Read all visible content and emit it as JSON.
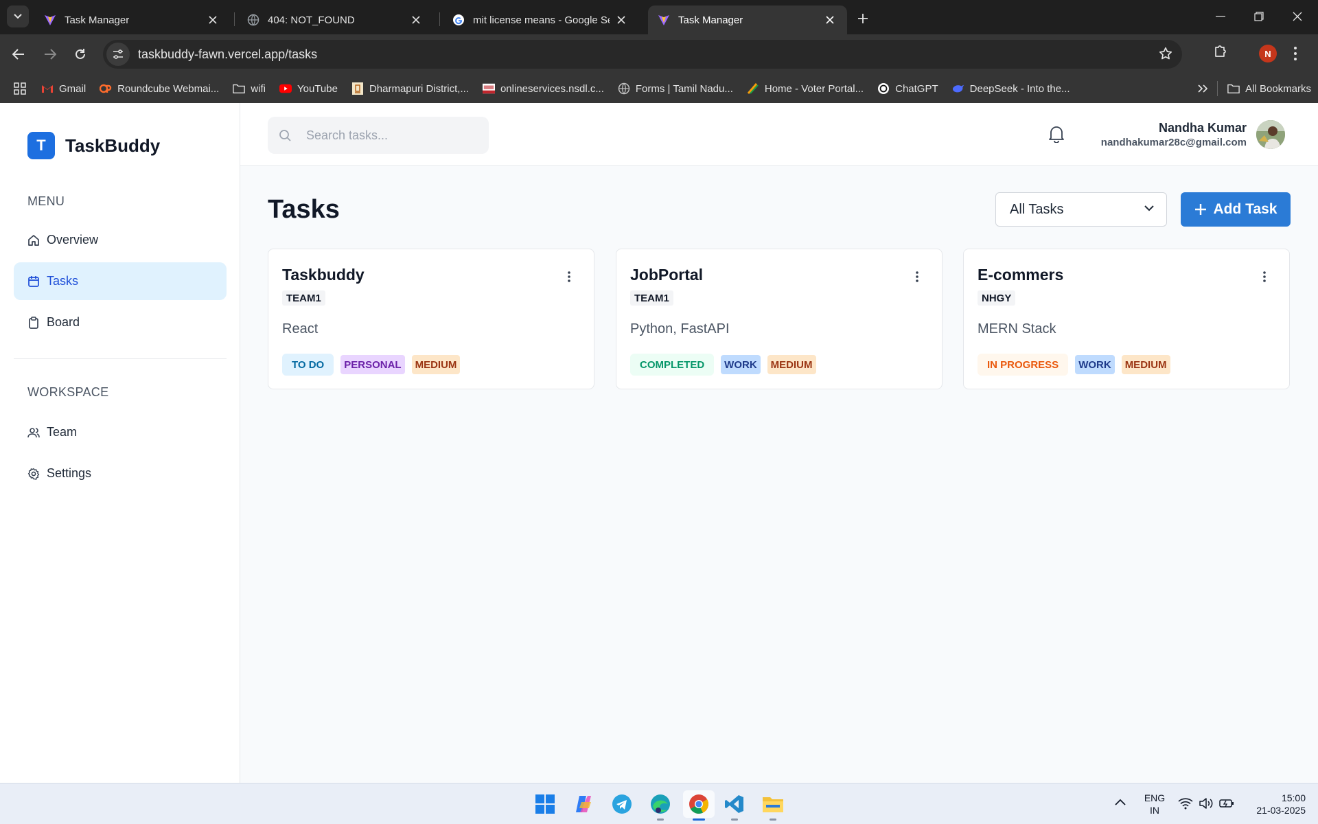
{
  "browser": {
    "tabs": [
      {
        "title": "Task Manager",
        "icon": "vite-icon",
        "active": false
      },
      {
        "title": "404: NOT_FOUND",
        "icon": "globe-icon",
        "active": false
      },
      {
        "title": "mit license means - Google Sea",
        "icon": "google-icon",
        "active": false
      },
      {
        "title": "Task Manager",
        "icon": "vite-icon",
        "active": true
      }
    ],
    "url": "taskbuddy-fawn.vercel.app/tasks",
    "profile_initial": "N",
    "bookmarks": [
      {
        "label": "Gmail",
        "icon": "gmail-icon"
      },
      {
        "label": "Roundcube Webmai...",
        "icon": "cpanel-icon"
      },
      {
        "label": "wifi",
        "icon": "folder-icon"
      },
      {
        "label": "YouTube",
        "icon": "youtube-icon"
      },
      {
        "label": "Dharmapuri District,...",
        "icon": "emblem-icon"
      },
      {
        "label": "onlineservices.nsdl.c...",
        "icon": "nsdl-icon"
      },
      {
        "label": "Forms | Tamil Nadu...",
        "icon": "globe-icon"
      },
      {
        "label": "Home - Voter Portal...",
        "icon": "voter-icon"
      },
      {
        "label": "ChatGPT",
        "icon": "chatgpt-icon"
      },
      {
        "label": "DeepSeek - Into the...",
        "icon": "deepseek-icon"
      }
    ],
    "all_bookmarks": "All Bookmarks"
  },
  "app": {
    "brand": {
      "initial": "T",
      "name": "TaskBuddy"
    },
    "sidebar": {
      "menu_title": "MENU",
      "menu_items": [
        {
          "label": "Overview",
          "icon": "home-icon"
        },
        {
          "label": "Tasks",
          "icon": "calendar-icon"
        },
        {
          "label": "Board",
          "icon": "clipboard-icon"
        }
      ],
      "workspace_title": "WORKSPACE",
      "workspace_items": [
        {
          "label": "Team",
          "icon": "users-icon"
        },
        {
          "label": "Settings",
          "icon": "settings-icon"
        }
      ]
    },
    "header": {
      "search_placeholder": "Search tasks...",
      "user_name": "Nandha Kumar",
      "user_email": "nandhakumar28c@gmail.com"
    },
    "main": {
      "title": "Tasks",
      "filter_value": "All Tasks",
      "add_button": "Add Task",
      "tasks": [
        {
          "title": "Taskbuddy",
          "team": "TEAM1",
          "description": "React",
          "status": "TO DO",
          "category": "PERSONAL",
          "priority": "MEDIUM"
        },
        {
          "title": "JobPortal",
          "team": "TEAM1",
          "description": "Python, FastAPI",
          "status": "COMPLETED",
          "category": "WORK",
          "priority": "MEDIUM"
        },
        {
          "title": "E-commers",
          "team": "NHGY",
          "description": "MERN Stack",
          "status": "IN PROGRESS",
          "category": "WORK",
          "priority": "MEDIUM"
        }
      ]
    }
  },
  "taskbar": {
    "apps": [
      "windows-start-icon",
      "copilot-icon",
      "telegram-icon",
      "edge-icon",
      "chrome-icon",
      "vscode-icon",
      "file-explorer-icon"
    ],
    "language": "ENG",
    "region": "IN",
    "time": "15:00",
    "date": "21-03-2025"
  },
  "colors": {
    "accent": "#2b7bd6",
    "sidebar_active_bg": "#e0f2fe",
    "todo": "#0369a1",
    "completed": "#059669",
    "in_progress": "#ea580c"
  }
}
